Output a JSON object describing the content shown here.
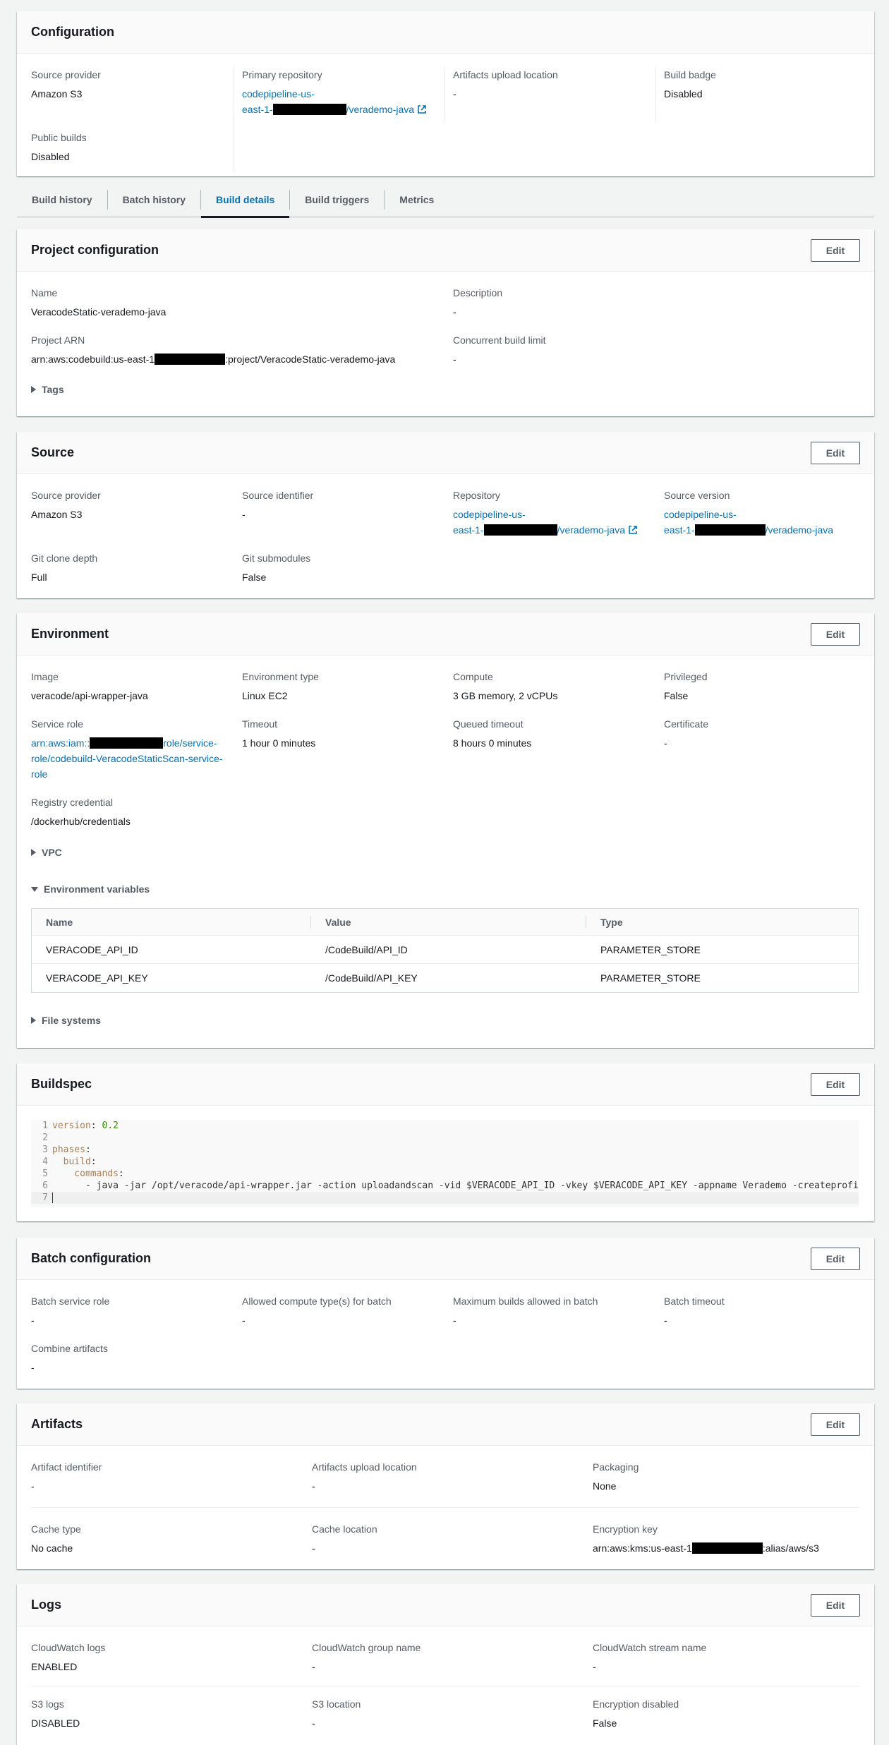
{
  "configuration": {
    "title": "Configuration",
    "source_provider": {
      "label": "Source provider",
      "value": "Amazon S3"
    },
    "primary_repository": {
      "label": "Primary repository",
      "value_line1": "codepipeline-us-",
      "value_line2_prefix": "east-1-",
      "value_line2_suffix": "/verademo-java"
    },
    "artifacts_upload_location": {
      "label": "Artifacts upload location",
      "value": "-"
    },
    "build_badge": {
      "label": "Build badge",
      "value": "Disabled"
    },
    "public_builds": {
      "label": "Public builds",
      "value": "Disabled"
    }
  },
  "tabs": [
    {
      "label": "Build history"
    },
    {
      "label": "Batch history"
    },
    {
      "label": "Build details",
      "active": true
    },
    {
      "label": "Build triggers"
    },
    {
      "label": "Metrics"
    }
  ],
  "project_configuration": {
    "title": "Project configuration",
    "edit_label": "Edit",
    "name": {
      "label": "Name",
      "value": "VeracodeStatic-verademo-java"
    },
    "description": {
      "label": "Description",
      "value": "-"
    },
    "project_arn": {
      "label": "Project ARN",
      "value_prefix": "arn:aws:codebuild:us-east-1",
      "value_suffix": ":project/VeracodeStatic-verademo-java"
    },
    "concurrent_build_limit": {
      "label": "Concurrent build limit",
      "value": "-"
    },
    "tags_label": "Tags"
  },
  "source": {
    "title": "Source",
    "edit_label": "Edit",
    "source_provider": {
      "label": "Source provider",
      "value": "Amazon S3"
    },
    "source_identifier": {
      "label": "Source identifier",
      "value": "-"
    },
    "repository": {
      "label": "Repository",
      "value_line1": "codepipeline-us-",
      "value_line2_prefix": "east-1-",
      "value_line2_suffix": "/verademo-java"
    },
    "source_version": {
      "label": "Source version",
      "value_line1": "codepipeline-us-",
      "value_line2_prefix": "east-1-",
      "value_line2_suffix": "/verademo-java"
    },
    "git_clone_depth": {
      "label": "Git clone depth",
      "value": "Full"
    },
    "git_submodules": {
      "label": "Git submodules",
      "value": "False"
    }
  },
  "environment": {
    "title": "Environment",
    "edit_label": "Edit",
    "image": {
      "label": "Image",
      "value": "veracode/api-wrapper-java"
    },
    "environment_type": {
      "label": "Environment type",
      "value": "Linux EC2"
    },
    "compute": {
      "label": "Compute",
      "value": "3 GB memory, 2 vCPUs"
    },
    "privileged": {
      "label": "Privileged",
      "value": "False"
    },
    "service_role": {
      "label": "Service role",
      "value_line1_prefix": "arn:aws:iam::",
      "value_line1_suffix": "role/service-",
      "value_line2": "role/codebuild-VeracodeStaticScan-service-",
      "value_line3": "role"
    },
    "timeout": {
      "label": "Timeout",
      "value": "1 hour 0 minutes"
    },
    "queued_timeout": {
      "label": "Queued timeout",
      "value": "8 hours 0 minutes"
    },
    "certificate": {
      "label": "Certificate",
      "value": "-"
    },
    "registry_credential": {
      "label": "Registry credential",
      "value": "/dockerhub/credentials"
    },
    "vpc_label": "VPC",
    "env_vars_label": "Environment variables",
    "env_vars_columns": [
      "Name",
      "Value",
      "Type"
    ],
    "env_vars_rows": [
      [
        "VERACODE_API_ID",
        "/CodeBuild/API_ID",
        "PARAMETER_STORE"
      ],
      [
        "VERACODE_API_KEY",
        "/CodeBuild/API_KEY",
        "PARAMETER_STORE"
      ]
    ],
    "file_systems_label": "File systems"
  },
  "buildspec": {
    "title": "Buildspec",
    "edit_label": "Edit",
    "lines": [
      {
        "n": "1",
        "key": "version",
        "rest": "0.2"
      },
      {
        "n": "2",
        "text": ""
      },
      {
        "n": "3",
        "key": "phases",
        "rest": ""
      },
      {
        "n": "4",
        "key": "  build",
        "rest": ""
      },
      {
        "n": "5",
        "key": "    commands",
        "rest": ""
      },
      {
        "n": "6",
        "text": "      - java -jar /opt/veracode/api-wrapper.jar -action uploadandscan -vid $VERACODE_API_ID -vkey $VERACODE_API_KEY -appname Verademo -createprofi"
      },
      {
        "n": "7",
        "text": ""
      }
    ]
  },
  "batch_configuration": {
    "title": "Batch configuration",
    "edit_label": "Edit",
    "batch_service_role": {
      "label": "Batch service role",
      "value": "-"
    },
    "allowed_compute": {
      "label": "Allowed compute type(s) for batch",
      "value": "-"
    },
    "max_builds": {
      "label": "Maximum builds allowed in batch",
      "value": "-"
    },
    "batch_timeout": {
      "label": "Batch timeout",
      "value": "-"
    },
    "combine_artifacts": {
      "label": "Combine artifacts",
      "value": "-"
    }
  },
  "artifacts": {
    "title": "Artifacts",
    "edit_label": "Edit",
    "artifact_identifier": {
      "label": "Artifact identifier",
      "value": "-"
    },
    "artifacts_upload_location": {
      "label": "Artifacts upload location",
      "value": "-"
    },
    "packaging": {
      "label": "Packaging",
      "value": "None"
    },
    "cache_type": {
      "label": "Cache type",
      "value": "No cache"
    },
    "cache_location": {
      "label": "Cache location",
      "value": "-"
    },
    "encryption_key": {
      "label": "Encryption key",
      "value_prefix": "arn:aws:kms:us-east-1",
      "value_suffix": ":alias/aws/s3"
    }
  },
  "logs": {
    "title": "Logs",
    "edit_label": "Edit",
    "cloudwatch_logs": {
      "label": "CloudWatch logs",
      "value": "ENABLED"
    },
    "cloudwatch_group": {
      "label": "CloudWatch group name",
      "value": "-"
    },
    "cloudwatch_stream": {
      "label": "CloudWatch stream name",
      "value": "-"
    },
    "s3_logs": {
      "label": "S3 logs",
      "value": "DISABLED"
    },
    "s3_location": {
      "label": "S3 location",
      "value": "-"
    },
    "encryption_disabled": {
      "label": "Encryption disabled",
      "value": "False"
    }
  }
}
